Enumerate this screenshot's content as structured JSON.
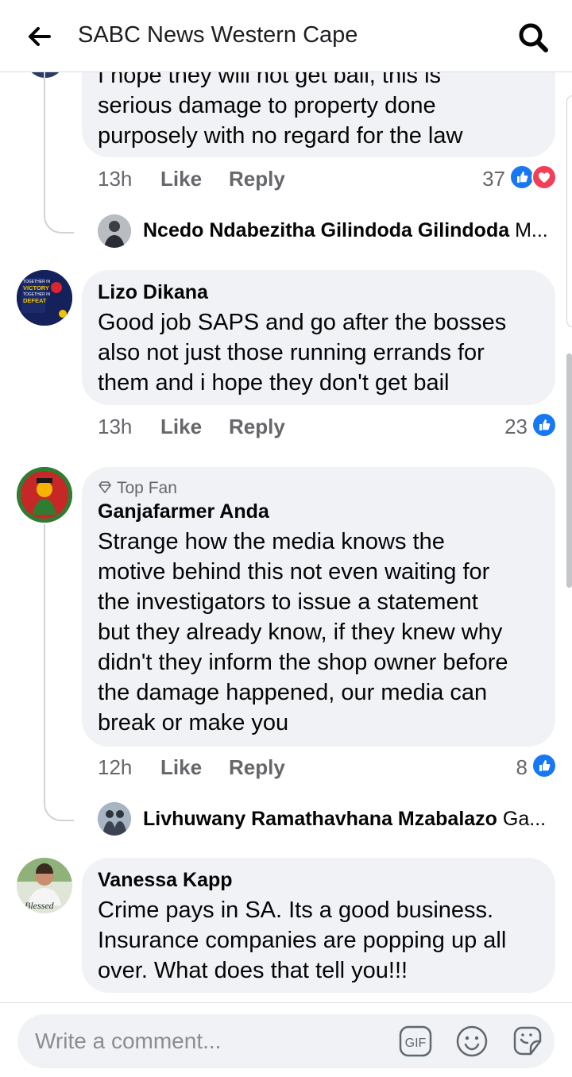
{
  "header": {
    "title": "SABC News Western Cape",
    "back_icon": "arrow-left-icon",
    "search_icon": "search-icon"
  },
  "comments": [
    {
      "text_lines": [
        "I hope they will not get bail, this is",
        "serious damage to property done",
        "purposely with no regard for the law"
      ],
      "time": "13h",
      "like": "Like",
      "reply": "Reply",
      "reaction_count": "37",
      "reactions": [
        "like",
        "love"
      ],
      "reply_preview": {
        "name": "Ncedo Ndabezitha Gilindoda Gilindoda",
        "suffix": "M..."
      }
    },
    {
      "author": "Lizo Dikana",
      "avatar_text": [
        "TOGETHER IN",
        "VICTORY",
        "TOGETHER IN",
        "DEFEAT"
      ],
      "text_lines": [
        "Good job SAPS and go after the bosses",
        "also not just those running errands for",
        "them and i hope they don't get bail"
      ],
      "time": "13h",
      "like": "Like",
      "reply": "Reply",
      "reaction_count": "23",
      "reactions": [
        "like"
      ]
    },
    {
      "badge": "Top Fan",
      "author": "Ganjafarmer Anda",
      "text_lines": [
        "Strange how the media knows the",
        "motive behind this not even waiting for",
        "the investigators to issue a statement",
        "but they already know, if they knew why",
        "didn't they inform the shop owner before",
        "the damage happened, our media can",
        "break or make you"
      ],
      "time": "12h",
      "like": "Like",
      "reply": "Reply",
      "reaction_count": "8",
      "reactions": [
        "like"
      ],
      "reply_preview": {
        "name": "Livhuwany Ramathavhana Mzabalazo",
        "suffix": "Ga..."
      }
    },
    {
      "author": "Vanessa Kapp",
      "avatar_text": "Blessed",
      "text_lines": [
        "Crime pays in SA. Its a good business.",
        "Insurance companies are popping up all",
        "over. What does that tell you!!!"
      ]
    }
  ],
  "composer": {
    "placeholder": "Write a comment...",
    "gif_label": "GIF",
    "icons": [
      "gif-icon",
      "emoji-icon",
      "sticker-icon"
    ]
  },
  "colors": {
    "accent": "#1877f2",
    "love": "#f33e58",
    "bubble": "#f0f2f5",
    "muted": "#65676b"
  }
}
